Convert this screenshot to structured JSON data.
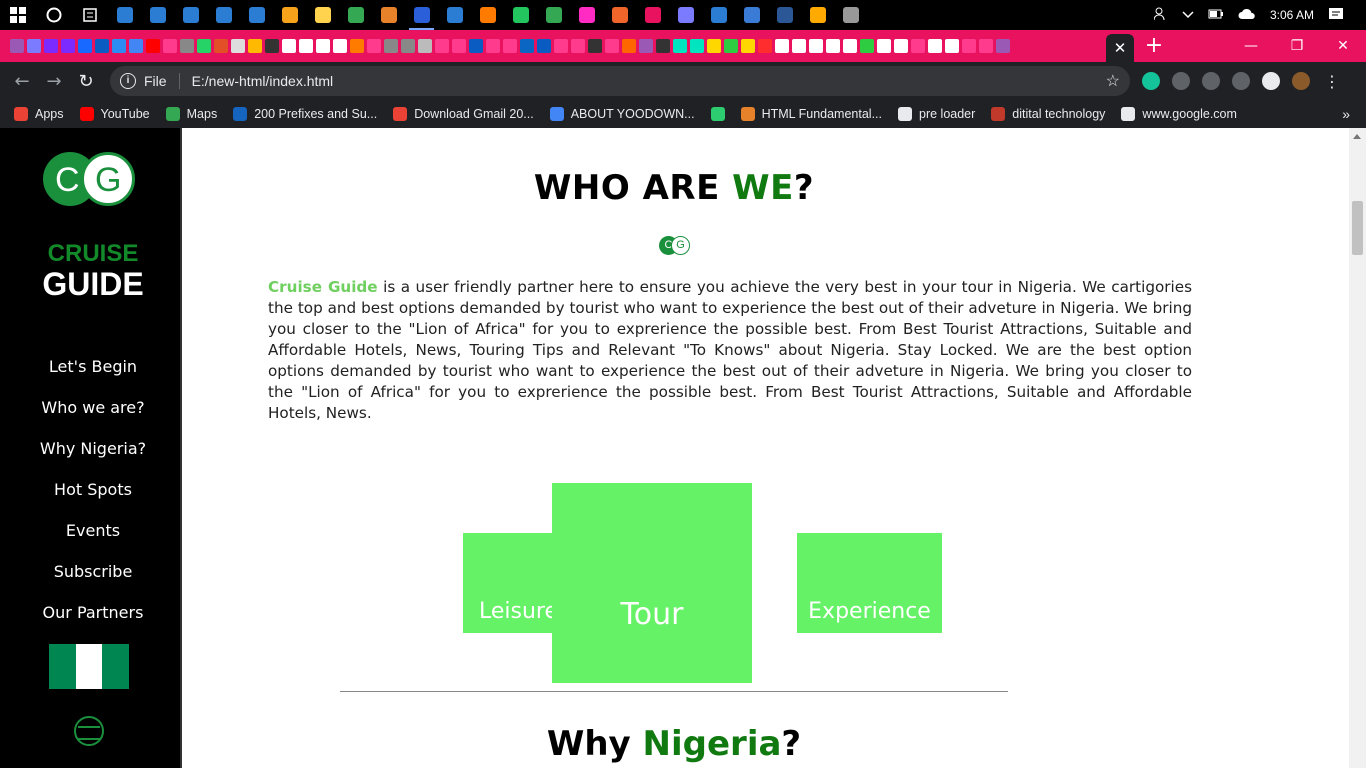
{
  "taskbar": {
    "app_colors": [
      "#2b7cd3",
      "#2b7cd3",
      "#2b7cd3",
      "#2b7cd3",
      "#2b7cd3",
      "#f7a21b",
      "#ffd34e",
      "#35a853",
      "#e8822a",
      "#2b5fd9",
      "#2b7cd3",
      "#ff7b00",
      "#23c55e",
      "#35a853",
      "#ff2bc2",
      "#f06529",
      "#e8125f",
      "#7b7bff",
      "#2b7cd3",
      "#3a7bd5",
      "#2b5797",
      "#ffaa00",
      "#999999"
    ],
    "clock": "3:06 AM",
    "tray_icons": [
      "people-icon",
      "chevron-up-icon",
      "battery-icon",
      "cloud-icon"
    ]
  },
  "tabstrip": {
    "tab_colors": [
      "#9b59b6",
      "#7b7bff",
      "#7b2bff",
      "#7b2bff",
      "#1769ff",
      "#0a5cc2",
      "#2c8cf4",
      "#4285f4",
      "#ff0000",
      "#ff3b8e",
      "#888888",
      "#25d366",
      "#e34f26",
      "#dddddd",
      "#ffb900",
      "#333333",
      "#ffffff",
      "#ffffff",
      "#ffffff",
      "#ffffff",
      "#ff7b00",
      "#ff3b8e",
      "#888888",
      "#888888",
      "#bbbbbb",
      "#ff3b8e",
      "#ff3b8e",
      "#0a5cc2",
      "#ff3b8e",
      "#ff3b8e",
      "#0a66c2",
      "#0a5cc2",
      "#ff3b8e",
      "#ff3b8e",
      "#333333",
      "#ff3b8e",
      "#ff6600",
      "#9b59b6",
      "#333333",
      "#00e5c0",
      "#00e5c0",
      "#ffd700",
      "#2ecc40",
      "#ffd700",
      "#ff2d2d",
      "#ffffff",
      "#ffffff",
      "#ffffff",
      "#ffffff",
      "#ffffff",
      "#2ecc40",
      "#ffffff",
      "#ffffff",
      "#ff3b8e",
      "#ffffff",
      "#ffffff",
      "#ff3b8e",
      "#ff3b8e",
      "#9b59b6"
    ],
    "close_tab": "✕",
    "new_tab": "+",
    "minimize": "—",
    "restore": "❐",
    "close_window": "✕"
  },
  "toolbar": {
    "back": "←",
    "forward": "→",
    "reload": "↻",
    "info": "i",
    "scheme": "File",
    "url": "E:/new-html/index.html",
    "star": "☆",
    "extension_colors": [
      "#15c39a",
      "#5f6368",
      "#5f6368",
      "#5f6368",
      "#e8eaed",
      "#8a5a2b"
    ],
    "menu": "⋮"
  },
  "bookmarks": {
    "items": [
      {
        "label": "Apps",
        "color": "#ea4335"
      },
      {
        "label": "YouTube",
        "color": "#ff0000"
      },
      {
        "label": "Maps",
        "color": "#34a853"
      },
      {
        "label": "200 Prefixes and Su...",
        "color": "#1565c0"
      },
      {
        "label": "Download Gmail 20...",
        "color": "#ea4335"
      },
      {
        "label": "ABOUT YOODOWN...",
        "color": "#4285f4"
      },
      {
        "label": "",
        "color": "#2ecc71"
      },
      {
        "label": "HTML Fundamental...",
        "color": "#e8822a"
      },
      {
        "label": "pre loader",
        "color": "#e8eaed"
      },
      {
        "label": "ditital technology",
        "color": "#c0392b"
      },
      {
        "label": "www.google.com",
        "color": "#e8eaed"
      }
    ],
    "more": "»"
  },
  "colors": {
    "accent_pink": "#e8125f",
    "brand_green": "#138a2a",
    "card_green": "#66f266",
    "sidebar_bg": "#000000"
  },
  "sidebar": {
    "logo_left": "C",
    "logo_right": "G",
    "brand_top": "CRUISE",
    "brand_bottom": "GUIDE",
    "nav": [
      "Let's Begin",
      "Who we are?",
      "Why Nigeria?",
      "Hot Spots",
      "Events",
      "Subscribe",
      "Our Partners"
    ],
    "flag_colors": [
      "#008751",
      "#ffffff",
      "#008751"
    ]
  },
  "content": {
    "about_title_pre": "WHO ARE ",
    "about_title_highlight": "WE",
    "about_title_post": "?",
    "mini_logo_left": "C",
    "mini_logo_right": "G",
    "about_highlight": "Cruise Guide",
    "about_body": " is a user friendly partner here to ensure you achieve the very best in your tour in Nigeria. We cartigories the top and best options demanded by tourist who want to experience the best out of their adveture in Nigeria. We bring you closer to the \"Lion of Africa\" for you to exprerience the possible best. From Best Tourist Attractions, Suitable and Affordable Hotels, News, Touring Tips and Relevant \"To Knows\" about Nigeria. Stay Locked. We are the best option options demanded by tourist who want to experience the best out of their adveture in Nigeria. We bring you closer to the \"Lion of Africa\" for you to exprerience the possible best. From Best Tourist Attractions, Suitable and Affordable Hotels, News.",
    "cards": {
      "leisure": "Leisure",
      "tour": "Tour",
      "experience": "Experience"
    },
    "why_title_pre": "Why ",
    "why_title_highlight": "Nigeria",
    "why_title_post": "?"
  }
}
